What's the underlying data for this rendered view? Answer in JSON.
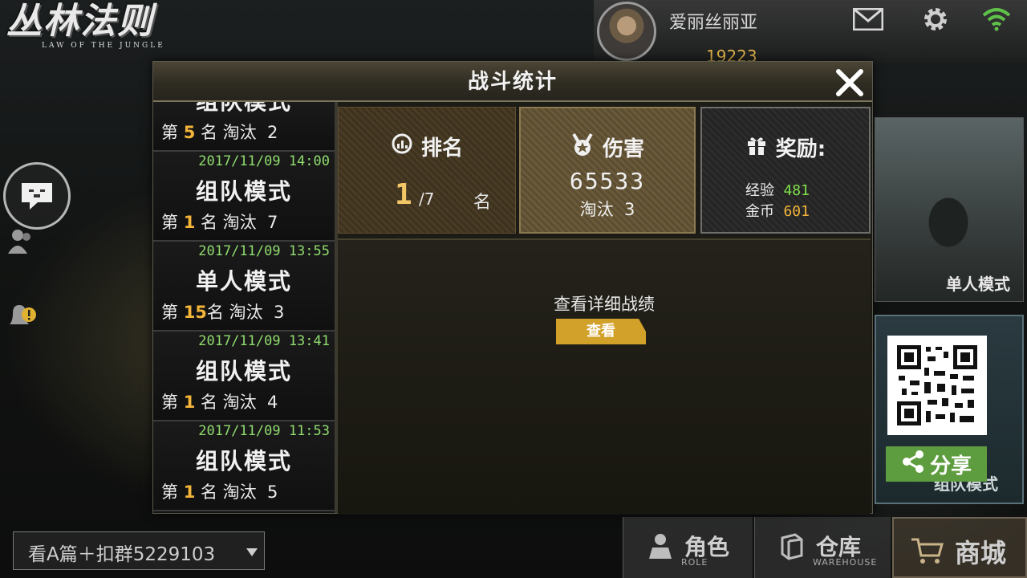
{
  "game": {
    "logo_cn": "丛林法则",
    "logo_en": "LAW OF THE JUNGLE"
  },
  "player": {
    "name": "爱丽丝丽亚",
    "gold": "19223"
  },
  "icons": {
    "mail": "mail-icon",
    "settings": "gear-icon",
    "wifi": "wifi-icon",
    "chat": "chat-bubble-icon",
    "friends": "friends-icon",
    "notice": "bell-alert-icon",
    "rank": "rank-chart-icon",
    "damage": "medal-icon",
    "reward": "gift-icon",
    "close": "close-icon",
    "share": "share-icon"
  },
  "colors": {
    "accent_gold": "#d2a12a",
    "rank_highlight": "#f3b43a",
    "time_green": "#8fdc6e",
    "exp_green": "#7fe04b",
    "share_green": "#5e9d3f"
  },
  "modal": {
    "title": "战斗统计",
    "history": [
      {
        "time": "",
        "mode": "组队模式",
        "prefix": "第 ",
        "rank": "5",
        "suffix": " 名 淘汰  2"
      },
      {
        "time": "2017/11/09 14:00",
        "mode": "组队模式",
        "prefix": "第 ",
        "rank": "1",
        "suffix": " 名 淘汰  7"
      },
      {
        "time": "2017/11/09 13:55",
        "mode": "单人模式",
        "prefix": "第 ",
        "rank": "15",
        "suffix": "名 淘汰  3"
      },
      {
        "time": "2017/11/09 13:41",
        "mode": "组队模式",
        "prefix": "第 ",
        "rank": "1",
        "suffix": " 名 淘汰  4"
      },
      {
        "time": "2017/11/09 11:53",
        "mode": "组队模式",
        "prefix": "第 ",
        "rank": "1",
        "suffix": " 名 淘汰  5"
      }
    ],
    "rank_card": {
      "title": "排名",
      "value": "1",
      "total": "/7",
      "unit": "名"
    },
    "damage_card": {
      "title": "伤害",
      "value": "65533",
      "kills": "淘汰  3"
    },
    "reward_card": {
      "title": "奖励:",
      "exp_label": "经验",
      "exp_value": "481",
      "coin_label": "金币",
      "coin_value": "601"
    },
    "details": {
      "text": "查看详细战绩",
      "button": "查看"
    }
  },
  "right_panel": {
    "solo_mode": "单人模式",
    "team_mode": "组队模式",
    "share": "分享"
  },
  "bottom": {
    "promo": "看A篇＋扣群5229103",
    "nav": [
      {
        "label": "角色",
        "sub": "ROLE"
      },
      {
        "label": "仓库",
        "sub": "WAREHOUSE"
      },
      {
        "label": "商城",
        "sub": ""
      }
    ]
  }
}
